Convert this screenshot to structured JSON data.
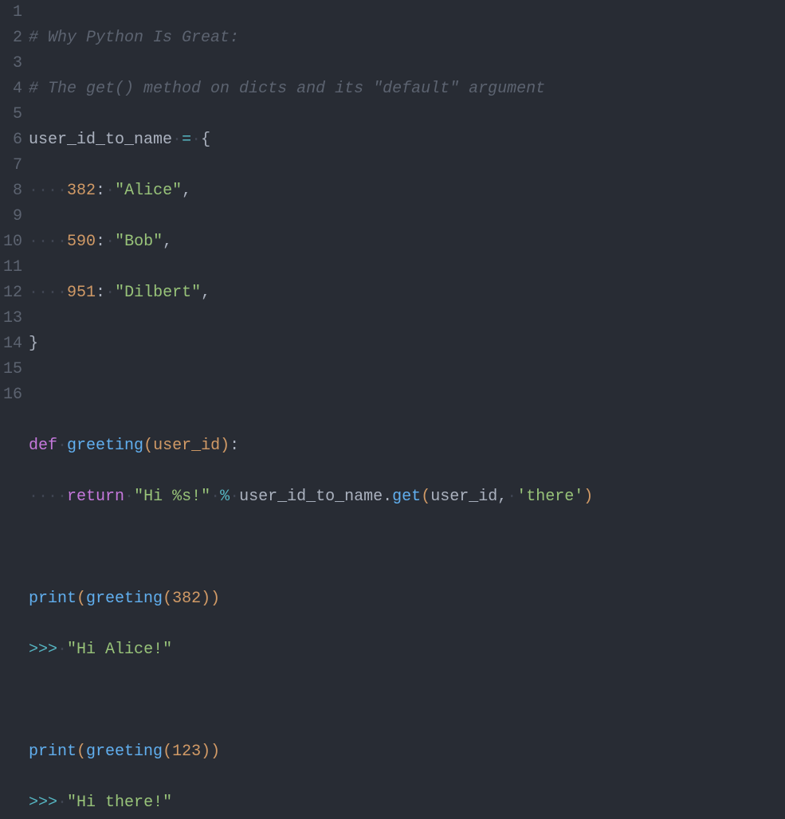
{
  "editor": {
    "line_numbers": [
      "1",
      "2",
      "3",
      "4",
      "5",
      "6",
      "7",
      "8",
      "9",
      "10",
      "11",
      "12",
      "13",
      "14",
      "15",
      "16"
    ],
    "whitespace_dot": "·",
    "tokens": {
      "l1_comment": "# Why Python Is Great:",
      "l2_comment": "# The get() method on dicts and its \"default\" argument",
      "l3_ident": "user_id_to_name",
      "l3_eq": "=",
      "l3_brace": "{",
      "l4_num": "382",
      "l4_colon": ":",
      "l4_str": "\"Alice\"",
      "l4_comma": ",",
      "l5_num": "590",
      "l5_colon": ":",
      "l5_str": "\"Bob\"",
      "l5_comma": ",",
      "l6_num": "951",
      "l6_colon": ":",
      "l6_str": "\"Dilbert\"",
      "l6_comma": ",",
      "l7_brace": "}",
      "l9_def": "def",
      "l9_name": "greeting",
      "l9_lp": "(",
      "l9_param": "user_id",
      "l9_rp": ")",
      "l9_colon": ":",
      "l10_return": "return",
      "l10_str": "\"Hi %s!\"",
      "l10_pct": "%",
      "l10_obj": "user_id_to_name",
      "l10_dot": ".",
      "l10_method": "get",
      "l10_lp": "(",
      "l10_arg1": "user_id",
      "l10_comma": ",",
      "l10_arg2": "'there'",
      "l10_rp": ")",
      "l12_print": "print",
      "l12_lp": "(",
      "l12_call": "greeting",
      "l12_lp2": "(",
      "l12_num": "382",
      "l12_rp2": ")",
      "l12_rp": ")",
      "l13_prompt": ">>>",
      "l13_str": "\"Hi Alice!\"",
      "l15_print": "print",
      "l15_lp": "(",
      "l15_call": "greeting",
      "l15_lp2": "(",
      "l15_num": "123",
      "l15_rp2": ")",
      "l15_rp": ")",
      "l16_prompt": ">>>",
      "l16_str": "\"Hi there!\""
    }
  }
}
